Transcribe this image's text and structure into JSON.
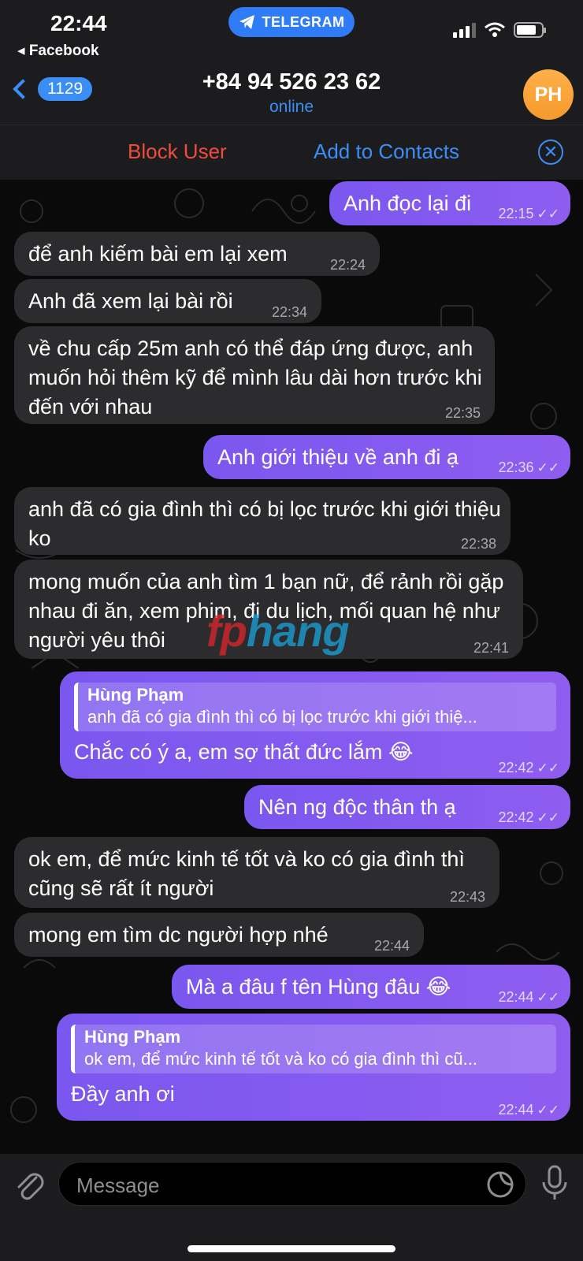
{
  "status_bar": {
    "time": "22:44",
    "back_app": "◂ Facebook",
    "pill": "TELEGRAM"
  },
  "header": {
    "unread_count": "1129",
    "title": "+84 94 526 23 62",
    "status": "online",
    "avatar_initials": "PH"
  },
  "action_bar": {
    "block": "Block User",
    "add": "Add to Contacts"
  },
  "watermark": {
    "part1": "fp",
    "part2": "hang"
  },
  "messages": [
    {
      "dir": "out",
      "text": "Anh đọc lại đi",
      "time": "22:15"
    },
    {
      "dir": "in",
      "text": "để anh kiếm bài em lại xem",
      "time": "22:24"
    },
    {
      "dir": "in",
      "text": "Anh đã xem lại bài rồi",
      "time": "22:34"
    },
    {
      "dir": "in",
      "text": "về chu cấp 25m anh có thể đáp ứng được, anh muốn hỏi thêm kỹ để mình lâu dài hơn trước khi đến với nhau",
      "time": "22:35"
    },
    {
      "dir": "out",
      "text": "Anh giới thiệu về anh đi ạ",
      "time": "22:36"
    },
    {
      "dir": "in",
      "text": "anh đã có gia đình thì có bị lọc trước khi giới thiệu ko",
      "time": "22:38"
    },
    {
      "dir": "in",
      "text": "mong muốn của anh tìm 1 bạn nữ, để rảnh rồi gặp nhau đi ăn, xem phim, đi du lịch, mối quan hệ như người yêu thôi",
      "time": "22:41"
    },
    {
      "dir": "out",
      "reply_name": "Hùng Phạm",
      "reply_text": "anh đã có gia đình thì có bị lọc trước khi giới thiệ...",
      "text": "Chắc có ý a, em sợ thất đức lắm 😂",
      "time": "22:42"
    },
    {
      "dir": "out",
      "text": "Nên ng độc thân th ạ",
      "time": "22:42"
    },
    {
      "dir": "in",
      "text": "ok em, để mức kinh tế tốt và ko có gia đình thì cũng sẽ rất ít người",
      "time": "22:43"
    },
    {
      "dir": "in",
      "text": "mong em tìm dc người hợp nhé",
      "time": "22:44"
    },
    {
      "dir": "out",
      "text": "Mà a đâu f tên Hùng đâu 😂",
      "time": "22:44"
    },
    {
      "dir": "out",
      "reply_name": "Hùng Phạm",
      "reply_text": "ok em, để mức kinh tế tốt và ko có gia đình thì cũ...",
      "text": "Đầy anh ơi",
      "time": "22:44"
    }
  ],
  "input": {
    "placeholder": "Message"
  },
  "icons": [
    "telegram-icon",
    "signal-icon",
    "wifi-icon",
    "battery-icon",
    "back-chevron-icon",
    "close-icon",
    "paperclip-icon",
    "sticker-icon",
    "microphone-icon",
    "read-ticks-icon"
  ],
  "colors": {
    "accent_blue": "#3a8ef6",
    "block_red": "#ef4c3f",
    "outgoing_purple": "#8a5cf0",
    "incoming_gray": "#2c2c2e",
    "avatar_orange": "#f7a23a"
  }
}
